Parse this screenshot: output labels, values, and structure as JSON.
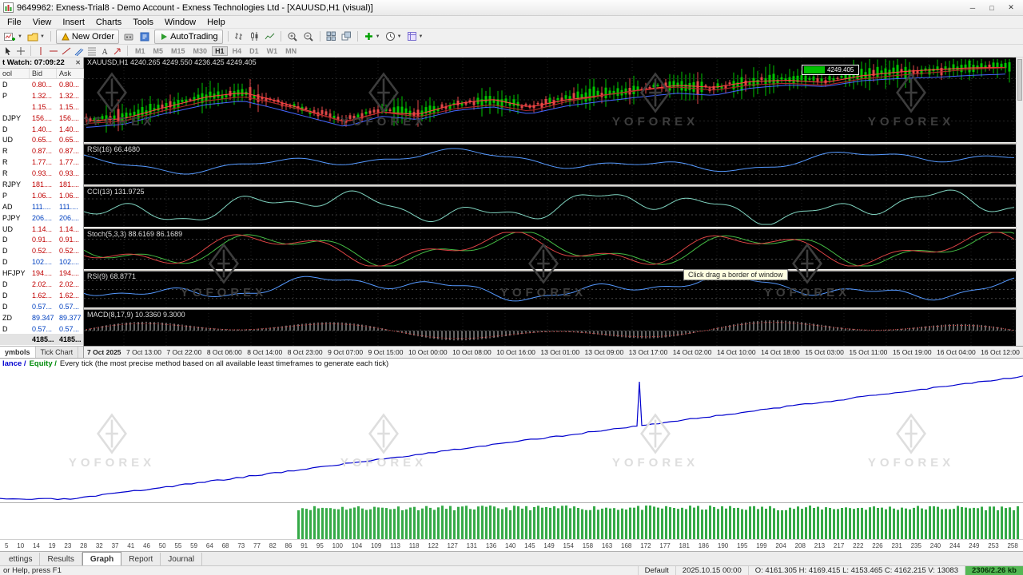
{
  "window": {
    "title": "9649962: Exness-Trial8 - Demo Account - Exness Technologies Ltd - [XAUUSD,H1 (visual)]",
    "controls": {
      "minimize": "─",
      "maximize": "□",
      "close": "✕"
    }
  },
  "menu": [
    "File",
    "View",
    "Insert",
    "Charts",
    "Tools",
    "Window",
    "Help"
  ],
  "toolbar": {
    "new_order": "New Order",
    "autotrading": "AutoTrading",
    "timeframes": [
      "M1",
      "M5",
      "M15",
      "M30",
      "H1",
      "H4",
      "D1",
      "W1",
      "MN"
    ],
    "active_timeframe": "H1"
  },
  "market_watch": {
    "title": "t Watch: 07:09:22",
    "columns": [
      "ool",
      "Bid",
      "Ask"
    ],
    "rows": [
      {
        "symbol": "D",
        "bid": "0.80...",
        "ask": "0.80...",
        "dir": "down"
      },
      {
        "symbol": "P",
        "bid": "1.32...",
        "ask": "1.32...",
        "dir": "down"
      },
      {
        "symbol": "",
        "bid": "1.15...",
        "ask": "1.15...",
        "dir": "down"
      },
      {
        "symbol": "DJPY",
        "bid": "156....",
        "ask": "156....",
        "dir": "down"
      },
      {
        "symbol": "D",
        "bid": "1.40...",
        "ask": "1.40...",
        "dir": "down"
      },
      {
        "symbol": "UD",
        "bid": "0.65...",
        "ask": "0.65...",
        "dir": "down"
      },
      {
        "symbol": "R",
        "bid": "0.87...",
        "ask": "0.87...",
        "dir": "down"
      },
      {
        "symbol": "R",
        "bid": "1.77...",
        "ask": "1.77...",
        "dir": "down"
      },
      {
        "symbol": "R",
        "bid": "0.93...",
        "ask": "0.93...",
        "dir": "down"
      },
      {
        "symbol": "RJPY",
        "bid": "181....",
        "ask": "181....",
        "dir": "down"
      },
      {
        "symbol": "P",
        "bid": "1.06...",
        "ask": "1.06...",
        "dir": "down"
      },
      {
        "symbol": "AD",
        "bid": "111....",
        "ask": "111....",
        "dir": "up"
      },
      {
        "symbol": "PJPY",
        "bid": "206....",
        "ask": "206....",
        "dir": "up"
      },
      {
        "symbol": "UD",
        "bid": "1.14...",
        "ask": "1.14...",
        "dir": "down"
      },
      {
        "symbol": "D",
        "bid": "0.91...",
        "ask": "0.91...",
        "dir": "down"
      },
      {
        "symbol": "D",
        "bid": "0.52...",
        "ask": "0.52...",
        "dir": "down"
      },
      {
        "symbol": "D",
        "bid": "102....",
        "ask": "102....",
        "dir": "up"
      },
      {
        "symbol": "HFJPY",
        "bid": "194....",
        "ask": "194....",
        "dir": "down"
      },
      {
        "symbol": "D",
        "bid": "2.02...",
        "ask": "2.02...",
        "dir": "down"
      },
      {
        "symbol": "D",
        "bid": "1.62...",
        "ask": "1.62...",
        "dir": "down"
      },
      {
        "symbol": "D",
        "bid": "0.57...",
        "ask": "0.57...",
        "dir": "up"
      },
      {
        "symbol": "ZD",
        "bid": "89.347",
        "ask": "89.377",
        "dir": "up"
      },
      {
        "symbol": "D",
        "bid": "0.57...",
        "ask": "0.57...",
        "dir": "up"
      },
      {
        "symbol": "",
        "bid": "4185...",
        "ask": "4185...",
        "dir": "down",
        "selected": true
      }
    ],
    "tabs": [
      "ymbols",
      "Tick Chart"
    ]
  },
  "chart": {
    "symbol_label": "XAUUSD,H1 4240.265 4249.550 4236.425 4249.405",
    "price_box": "4249.405",
    "watermark": "YOFOREX",
    "tooltip": "Click  drag a border of window",
    "panes": [
      {
        "label": "RSI(16) 66.4680"
      },
      {
        "label": "CCI(13) 131.9725"
      },
      {
        "label": "Stoch(5,3,3) 88.6169 86.1689"
      },
      {
        "label": "RSI(9) 68.8771"
      },
      {
        "label": "MACD(8,17,9) 10.3360 9.3000"
      }
    ],
    "time_axis": [
      "7 Oct 2025",
      "7 Oct 13:00",
      "7 Oct 22:00",
      "8 Oct 06:00",
      "8 Oct 14:00",
      "8 Oct 23:00",
      "9 Oct 07:00",
      "9 Oct 15:00",
      "10 Oct 00:00",
      "10 Oct 08:00",
      "10 Oct 16:00",
      "13 Oct 01:00",
      "13 Oct 09:00",
      "13 Oct 17:00",
      "14 Oct 02:00",
      "14 Oct 10:00",
      "14 Oct 18:00",
      "15 Oct 03:00",
      "15 Oct 11:00",
      "15 Oct 19:00",
      "16 Oct 04:00",
      "16 Oct 12:00"
    ]
  },
  "tester": {
    "header_balance": "lance /",
    "header_equity": "Equity /",
    "header_rest": "Every tick (the most precise method based on all available least timeframes to generate each tick)",
    "numbers": [
      "5",
      "10",
      "14",
      "19",
      "23",
      "28",
      "32",
      "37",
      "41",
      "46",
      "50",
      "55",
      "59",
      "64",
      "68",
      "73",
      "77",
      "82",
      "86",
      "91",
      "95",
      "100",
      "104",
      "109",
      "113",
      "118",
      "122",
      "127",
      "131",
      "136",
      "140",
      "145",
      "149",
      "154",
      "158",
      "163",
      "168",
      "172",
      "177",
      "181",
      "186",
      "190",
      "195",
      "199",
      "204",
      "208",
      "213",
      "217",
      "222",
      "226",
      "231",
      "235",
      "240",
      "244",
      "249",
      "253",
      "258"
    ],
    "tabs": [
      "ettings",
      "Results",
      "Graph",
      "Report",
      "Journal"
    ],
    "active_tab": "Graph"
  },
  "status_bar": {
    "help": "or Help, press F1",
    "profile": "Default",
    "datetime": "2025.10.15 00:00",
    "ohlcv": "O: 4161.305  H: 4169.415  L: 4153.465  C: 4162.215  V: 13083",
    "connection": "2306/2.26 kb"
  }
}
